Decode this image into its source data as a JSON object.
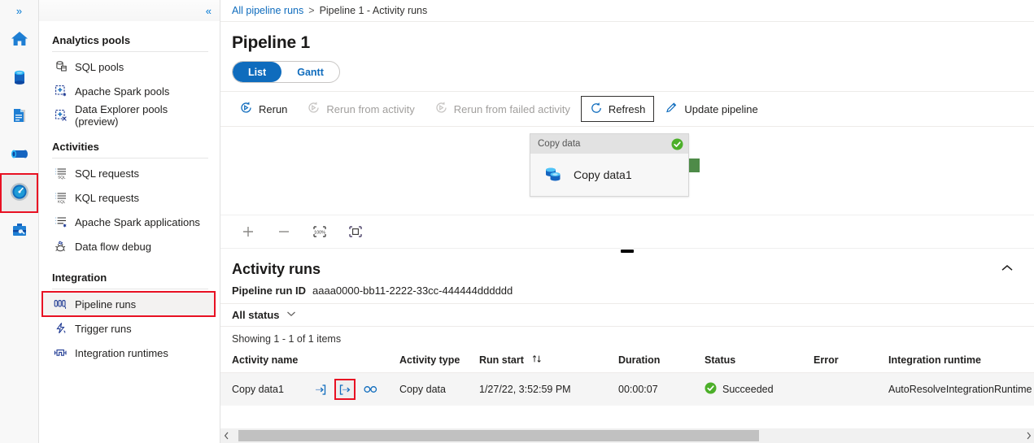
{
  "rail": {
    "expand_label": "»",
    "items": [
      {
        "name": "home",
        "label": "Home",
        "selected": false
      },
      {
        "name": "data",
        "label": "Data",
        "selected": false
      },
      {
        "name": "develop",
        "label": "Develop",
        "selected": false
      },
      {
        "name": "integrate",
        "label": "Integrate",
        "selected": false
      },
      {
        "name": "monitor",
        "label": "Monitor",
        "selected": true
      },
      {
        "name": "manage",
        "label": "Manage",
        "selected": false
      }
    ],
    "selection_highlight_color": "#e81123"
  },
  "sidebar": {
    "collapse_label": "«",
    "sections": [
      {
        "title": "Analytics pools",
        "items": [
          {
            "label": "SQL pools",
            "icon": "sql-pool-icon",
            "active": false
          },
          {
            "label": "Apache Spark pools",
            "icon": "spark-pool-icon",
            "active": false
          },
          {
            "label": "Data Explorer pools (preview)",
            "icon": "data-explorer-pool-icon",
            "active": false
          }
        ]
      },
      {
        "title": "Activities",
        "items": [
          {
            "label": "SQL requests",
            "icon": "sql-requests-icon",
            "active": false
          },
          {
            "label": "KQL requests",
            "icon": "kql-requests-icon",
            "active": false
          },
          {
            "label": "Apache Spark applications",
            "icon": "spark-applications-icon",
            "active": false
          },
          {
            "label": "Data flow debug",
            "icon": "data-flow-debug-icon",
            "active": false
          }
        ]
      },
      {
        "title": "Integration",
        "items": [
          {
            "label": "Pipeline runs",
            "icon": "pipeline-runs-icon",
            "active": true
          },
          {
            "label": "Trigger runs",
            "icon": "trigger-runs-icon",
            "active": false
          },
          {
            "label": "Integration runtimes",
            "icon": "integration-runtimes-icon",
            "active": false
          }
        ]
      }
    ]
  },
  "breadcrumb": {
    "root": "All pipeline runs",
    "separator": ">",
    "current": "Pipeline 1 - Activity runs"
  },
  "header": {
    "title": "Pipeline 1"
  },
  "view_toggle": {
    "selected": "List",
    "options": [
      "List",
      "Gantt"
    ]
  },
  "toolbar": {
    "rerun": "Rerun",
    "rerun_from_activity": "Rerun from activity",
    "rerun_from_failed": "Rerun from failed activity",
    "refresh": "Refresh",
    "update_pipeline": "Update pipeline"
  },
  "canvas": {
    "node": {
      "type_label": "Copy data",
      "name": "Copy data1",
      "status": "succeeded",
      "status_color": "#4caf29",
      "port_color": "#4e8b48"
    },
    "zoom_controls": [
      {
        "name": "zoom-in-icon",
        "label": "+"
      },
      {
        "name": "zoom-out-icon",
        "label": "−"
      },
      {
        "name": "zoom-to-100-icon",
        "label": "100%"
      },
      {
        "name": "zoom-to-fit-icon",
        "label": "fit"
      }
    ]
  },
  "activity_runs": {
    "title": "Activity runs",
    "run_id_label": "Pipeline run ID",
    "run_id_value": "aaaa0000-bb11-2222-33cc-444444dddddd",
    "status_filter": "All status",
    "showing": "Showing 1 - 1 of 1 items",
    "columns": [
      "Activity name",
      "Activity type",
      "Run start",
      "Duration",
      "Status",
      "Error",
      "Integration runtime"
    ],
    "sort_column": "Run start",
    "rows": [
      {
        "activity_name": "Copy data1",
        "actions": [
          "input-icon",
          "output-icon",
          "details-icon"
        ],
        "highlighted_action": "output-icon",
        "activity_type": "Copy data",
        "run_start": "1/27/22, 3:52:59 PM",
        "duration": "00:00:07",
        "status": "Succeeded",
        "status_color": "#4caf29",
        "error": "",
        "integration_runtime": "AutoResolveIntegrationRuntime"
      }
    ]
  }
}
